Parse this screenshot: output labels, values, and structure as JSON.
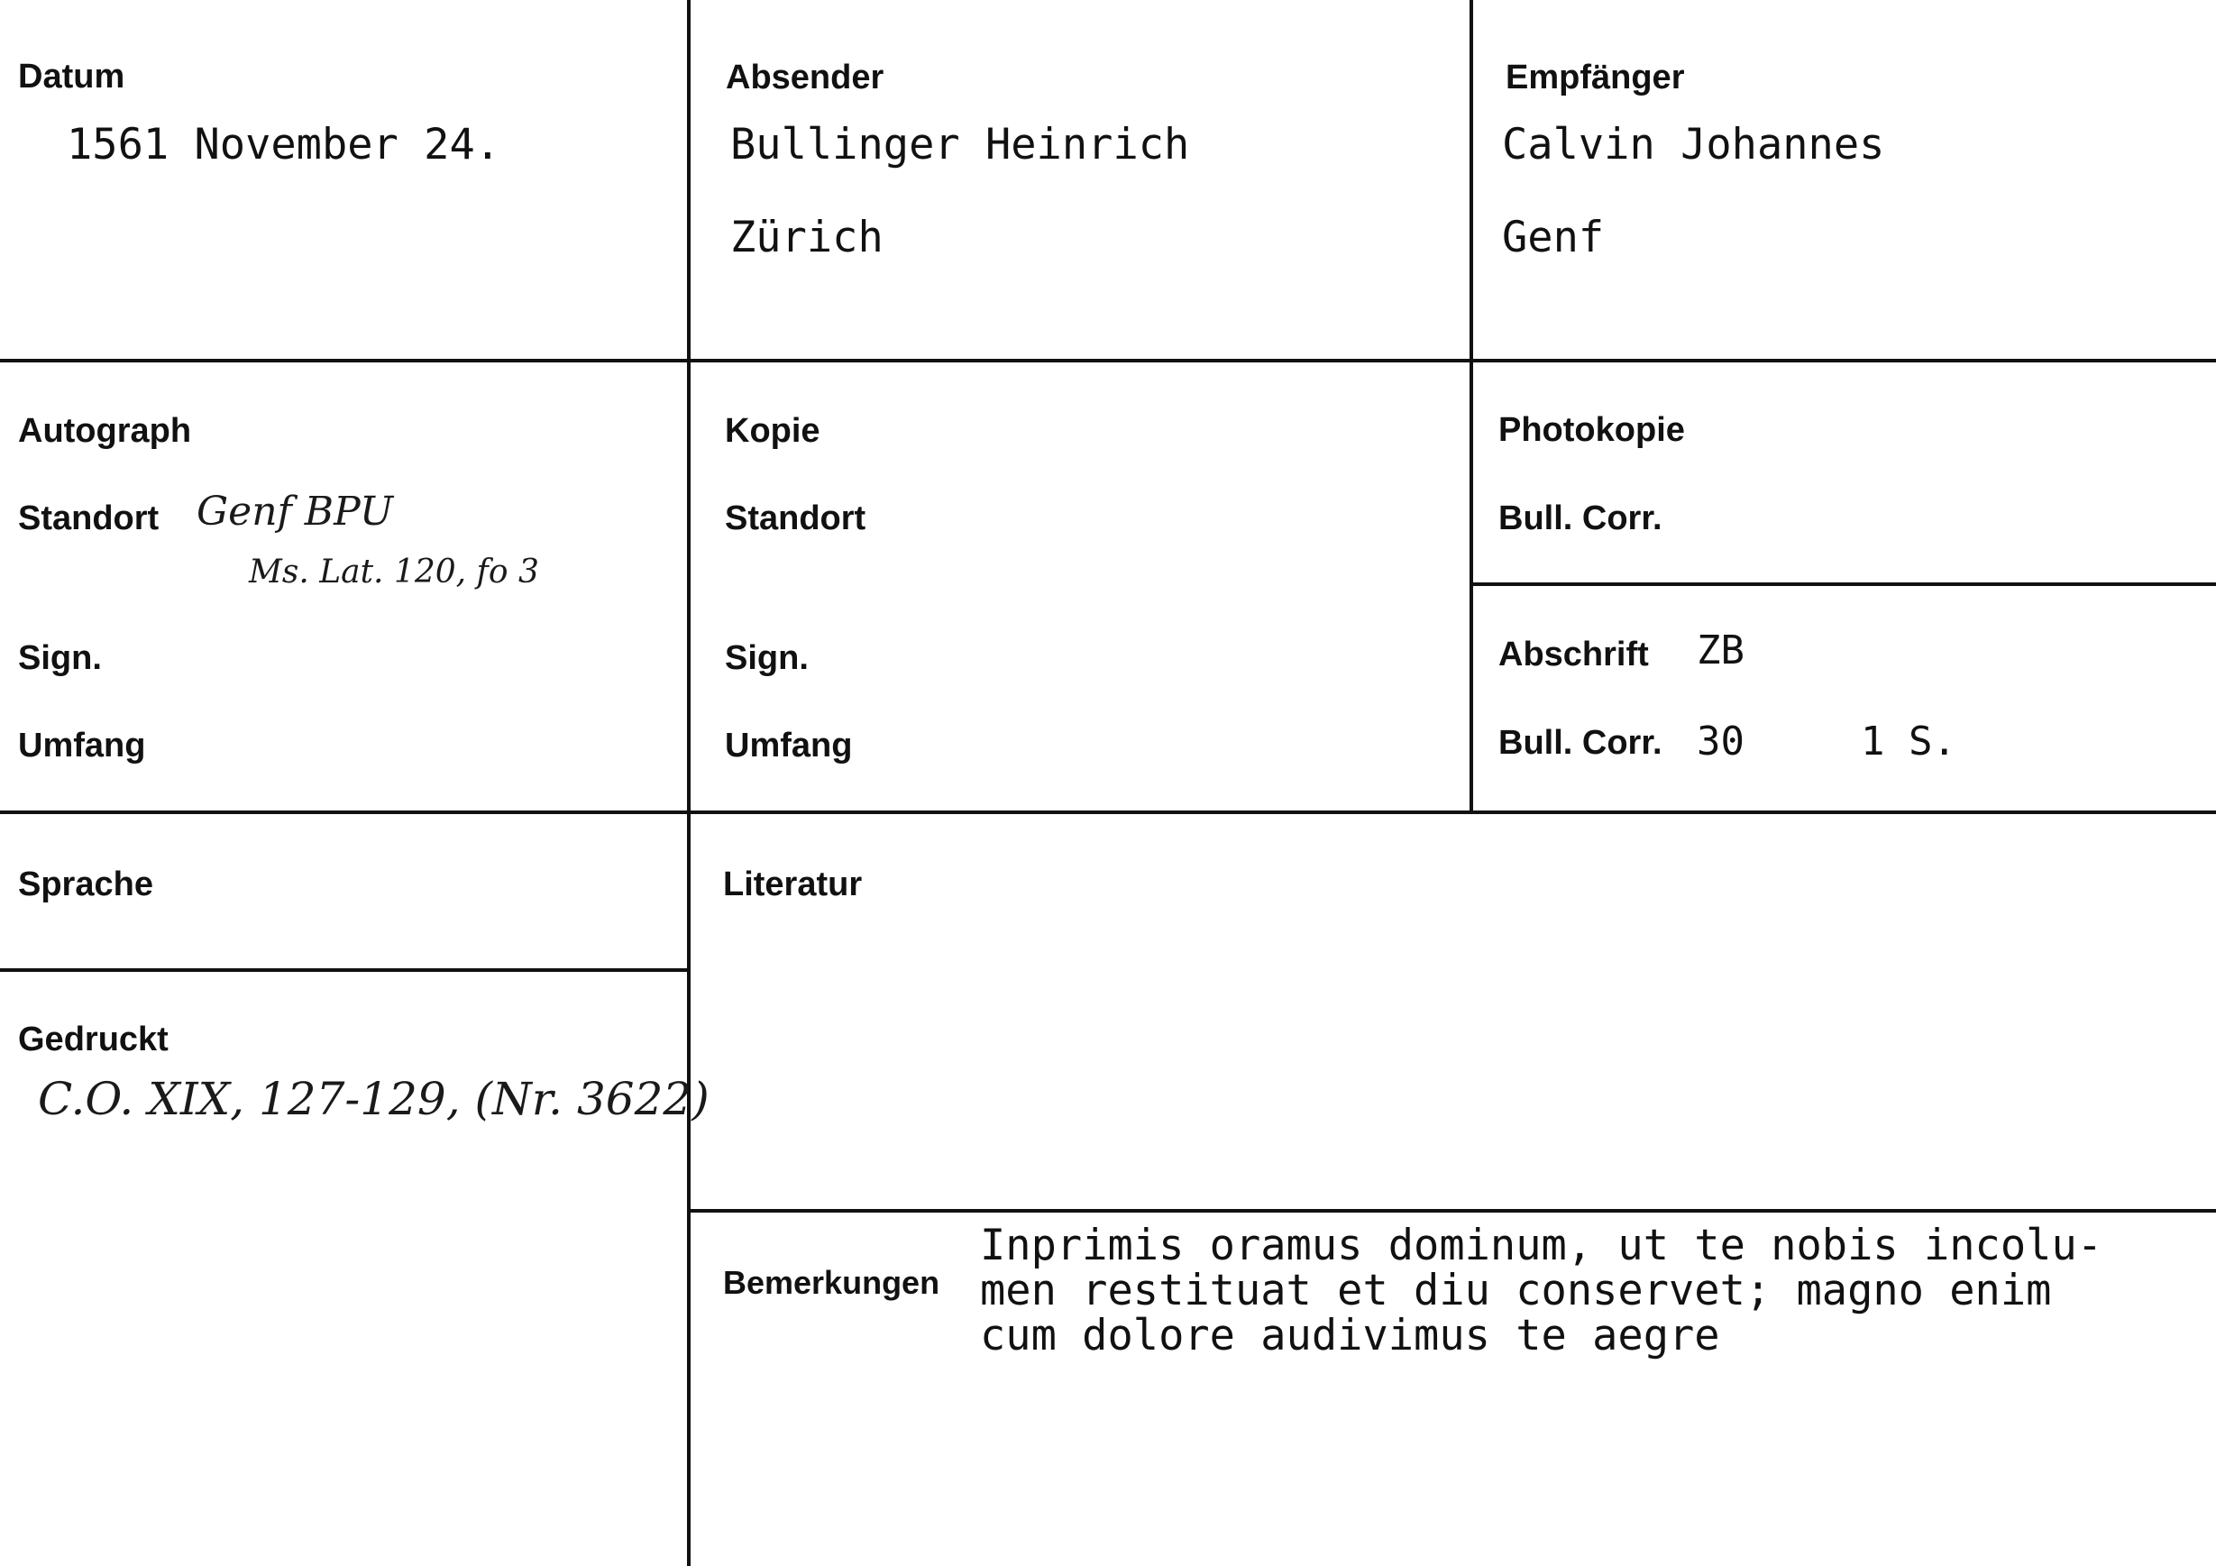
{
  "labels": {
    "datum": "Datum",
    "absender": "Absender",
    "empfaenger": "Empfänger",
    "autograph": "Autograph",
    "autograph_standort": "Standort",
    "autograph_sign": "Sign.",
    "autograph_umfang": "Umfang",
    "kopie": "Kopie",
    "kopie_standort": "Standort",
    "kopie_sign": "Sign.",
    "kopie_umfang": "Umfang",
    "photokopie": "Photokopie",
    "photokopie_ref": "Bull. Corr.",
    "abschrift": "Abschrift",
    "abschrift_ref": "Bull. Corr.",
    "sprache": "Sprache",
    "literatur": "Literatur",
    "gedruckt": "Gedruckt",
    "bemerkungen": "Bemerkungen"
  },
  "values": {
    "datum": "1561 November 24.",
    "absender_name": "Bullinger Heinrich",
    "absender_ort": "Zürich",
    "empfaenger_name": "Calvin Johannes",
    "empfaenger_ort": "Genf",
    "abschrift_location": "ZB",
    "abschrift_number": "30",
    "abschrift_pages": "1 S."
  },
  "handwritten": {
    "standort_line1": "Genf BPU",
    "standort_line2": "Ms. Lat. 120, fo 3",
    "gedruckt": "C.O. XIX, 127-129, (Nr. 3622)"
  },
  "bemerkungen": [
    "Inprimis oramus dominum, ut te nobis incolu-",
    "men restituat et diu conservet; magno enim",
    "cum dolore audivimus te aegre"
  ]
}
